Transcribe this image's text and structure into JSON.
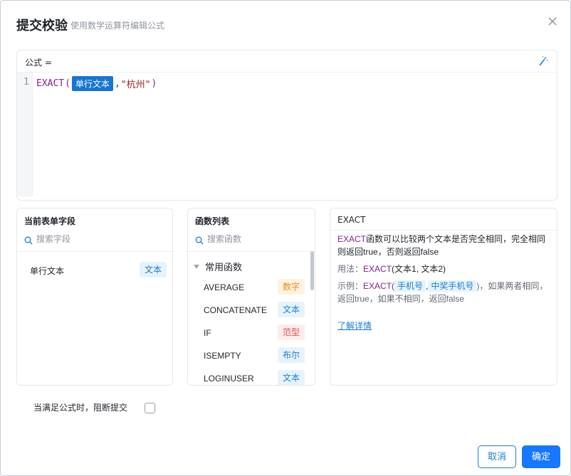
{
  "dialog": {
    "title": "提交校验",
    "subtitle": "使用数学运算符编辑公式",
    "close_icon": "close-icon"
  },
  "formula": {
    "label": "公式 =",
    "line_number": "1",
    "fn_name": "EXACT",
    "open_paren": "(",
    "field_chip": "单行文本",
    "comma": ",",
    "string_arg": "\"杭州\"",
    "close_paren": ")",
    "wand_icon": "magic-wand-icon"
  },
  "fields_panel": {
    "title": "当前表单字段",
    "search_placeholder": "搜索字段",
    "items": [
      {
        "name": "单行文本",
        "type": "文本"
      }
    ]
  },
  "functions_panel": {
    "title": "函数列表",
    "search_placeholder": "搜索函数",
    "group": "常用函数",
    "items": [
      {
        "name": "AVERAGE",
        "type": "数字"
      },
      {
        "name": "CONCATENATE",
        "type": "文本"
      },
      {
        "name": "IF",
        "type": "范型"
      },
      {
        "name": "ISEMPTY",
        "type": "布尔"
      },
      {
        "name": "LOGINUSER",
        "type": "文本"
      }
    ]
  },
  "help_panel": {
    "title": "EXACT",
    "desc_fn": "EXACT",
    "desc_text": "函数可以比较两个文本是否完全相同，完全相同则返回true，否则返回false",
    "usage_label": "用法：",
    "usage_fn": "EXACT",
    "usage_args": "(文本1, 文本2)",
    "example_label": "示例：",
    "example_fn": "EXACT",
    "example_open": "(",
    "example_arg1": "手机号",
    "example_comma": ",",
    "example_arg2": "中奖手机号",
    "example_rest": ")，如果两者相同，返回true，如果不相同，返回false",
    "link": "了解详情"
  },
  "footer": {
    "block_label": "当满足公式时，阻断提交",
    "cancel": "取消",
    "confirm": "确定"
  },
  "colors": {
    "accent": "#1677ff",
    "function": "#8a1e8c",
    "string": "#a11d1d"
  }
}
